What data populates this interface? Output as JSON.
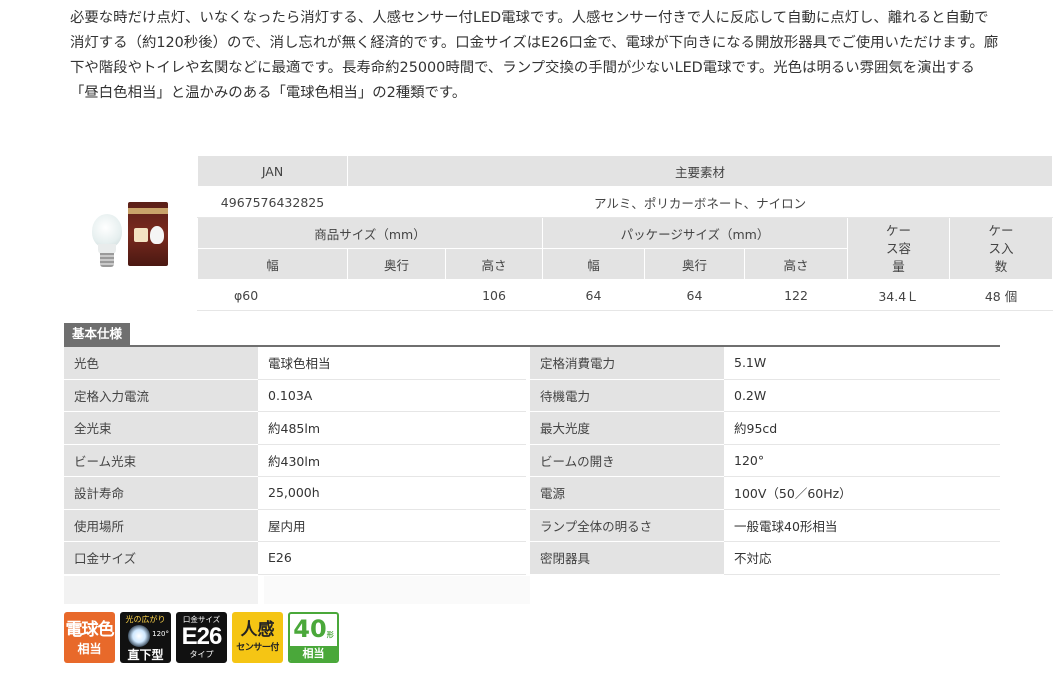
{
  "intro": "必要な時だけ点灯、いなくなったら消灯する、人感センサー付LED電球です。人感センサー付きで人に反応して自動に点灯し、離れると自動で消灯する（約120秒後）ので、消し忘れが無く経済的です。口金サイズはE26口金で、電球が下向きになる開放形器具でご使用いただけます。廊下や階段やトイレや玄関などに最適です。長寿命約25000時間で、ランプ交換の手間が少ないLED電球です。光色は明るい雰囲気を演出する「昼白色相当」と温かみのある「電球色相当」の2種類です。",
  "product_table": {
    "jan_label": "JAN",
    "material_label": "主要素材",
    "jan_value": "4967576432825",
    "material_value": "アルミ、ポリカーボネート、ナイロン",
    "product_size_label": "商品サイズ（mm）",
    "package_size_label": "パッケージサイズ（mm）",
    "case_volume_label": "ケース容量",
    "case_qty_label": "ケース入数",
    "width_label": "幅",
    "depth_label": "奥行",
    "height_label": "高さ",
    "values": {
      "product_width": "φ60",
      "product_depth": "",
      "product_height": "106",
      "package_width": "64",
      "package_depth": "64",
      "package_height": "122",
      "case_volume": "34.4Ｌ",
      "case_qty": "48 個"
    }
  },
  "basic_spec": {
    "title": "基本仕様",
    "rows": [
      {
        "k1": "光色",
        "v1": "電球色相当",
        "k2": "定格消費電力",
        "v2": "5.1W"
      },
      {
        "k1": "定格入力電流",
        "v1": "0.103A",
        "k2": "待機電力",
        "v2": "0.2W"
      },
      {
        "k1": "全光束",
        "v1": "約485lm",
        "k2": "最大光度",
        "v2": "約95cd"
      },
      {
        "k1": "ビーム光束",
        "v1": "約430lm",
        "k2": "ビームの開き",
        "v2": "120°"
      },
      {
        "k1": "設計寿命",
        "v1": "25,000h",
        "k2": "電源",
        "v2": "100V（50／60Hz）"
      },
      {
        "k1": "使用場所",
        "v1": "屋内用",
        "k2": "ランプ全体の明るさ",
        "v2": "一般電球40形相当"
      },
      {
        "k1": "口金サイズ",
        "v1": "E26",
        "k2": "密閉器具",
        "v2": "不対応"
      }
    ]
  },
  "badges": {
    "color": {
      "top": "電球色",
      "bottom": "相当"
    },
    "beam": {
      "top": "光の広がり",
      "deg": "120°",
      "bottom": "直下型"
    },
    "base": {
      "top": "口金サイズ",
      "main": "E26",
      "bottom": "タイプ"
    },
    "sensor": {
      "top": "人感",
      "bottom": "センサー付"
    },
    "watt": {
      "main": "40",
      "small": "形",
      "bottom": "相当"
    }
  },
  "colors": {
    "header_bg": "#e3e3e3",
    "section_bg": "#6f6f6f",
    "orange": "#e8692a",
    "yellow": "#f5c514",
    "green": "#4aa83a"
  }
}
